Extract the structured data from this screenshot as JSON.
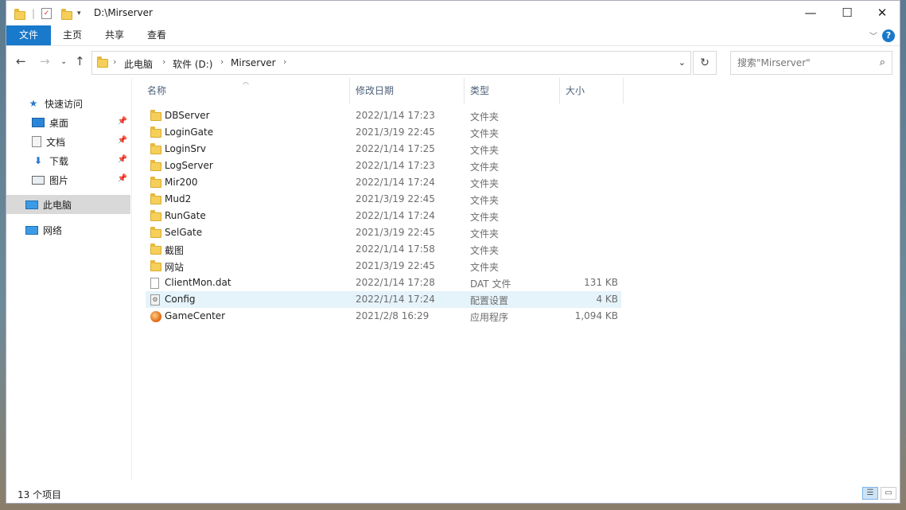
{
  "window": {
    "title": "D:\\Mirserver",
    "minimize_label": "—",
    "maximize_label": "☐",
    "close_label": "✕"
  },
  "ribbon": {
    "tabs": [
      {
        "label": "文件",
        "active": true
      },
      {
        "label": "主页"
      },
      {
        "label": "共享"
      },
      {
        "label": "查看"
      }
    ],
    "help_label": "?"
  },
  "address": {
    "crumbs": [
      "此电脑",
      "软件 (D:)",
      "Mirserver"
    ],
    "search_placeholder": "搜索\"Mirserver\""
  },
  "nav": {
    "items": [
      {
        "label": "快速访问",
        "icon": "star-icon"
      },
      {
        "label": "桌面",
        "icon": "desktop-icon",
        "pinned": true
      },
      {
        "label": "文档",
        "icon": "document-icon",
        "pinned": true
      },
      {
        "label": "下载",
        "icon": "download-icon",
        "pinned": true
      },
      {
        "label": "图片",
        "icon": "pictures-icon",
        "pinned": true
      },
      {
        "label": "此电脑",
        "icon": "computer-icon",
        "selected": true
      },
      {
        "label": "网络",
        "icon": "network-icon"
      }
    ]
  },
  "columns": {
    "name": "名称",
    "date": "修改日期",
    "type": "类型",
    "size": "大小"
  },
  "files": [
    {
      "name": "DBServer",
      "date": "2022/1/14 17:23",
      "type": "文件夹",
      "size": "",
      "icon": "folder-icon"
    },
    {
      "name": "LoginGate",
      "date": "2021/3/19 22:45",
      "type": "文件夹",
      "size": "",
      "icon": "folder-icon"
    },
    {
      "name": "LoginSrv",
      "date": "2022/1/14 17:25",
      "type": "文件夹",
      "size": "",
      "icon": "folder-icon"
    },
    {
      "name": "LogServer",
      "date": "2022/1/14 17:23",
      "type": "文件夹",
      "size": "",
      "icon": "folder-icon"
    },
    {
      "name": "Mir200",
      "date": "2022/1/14 17:24",
      "type": "文件夹",
      "size": "",
      "icon": "folder-icon"
    },
    {
      "name": "Mud2",
      "date": "2021/3/19 22:45",
      "type": "文件夹",
      "size": "",
      "icon": "folder-icon"
    },
    {
      "name": "RunGate",
      "date": "2022/1/14 17:24",
      "type": "文件夹",
      "size": "",
      "icon": "folder-icon"
    },
    {
      "name": "SelGate",
      "date": "2021/3/19 22:45",
      "type": "文件夹",
      "size": "",
      "icon": "folder-icon"
    },
    {
      "name": "截图",
      "date": "2022/1/14 17:58",
      "type": "文件夹",
      "size": "",
      "icon": "folder-icon"
    },
    {
      "name": "网站",
      "date": "2021/3/19 22:45",
      "type": "文件夹",
      "size": "",
      "icon": "folder-icon"
    },
    {
      "name": "ClientMon.dat",
      "date": "2022/1/14 17:28",
      "type": "DAT 文件",
      "size": "131 KB",
      "icon": "file-icon"
    },
    {
      "name": "Config",
      "date": "2022/1/14 17:24",
      "type": "配置设置",
      "size": "4 KB",
      "icon": "config-file-icon",
      "highlighted": true
    },
    {
      "name": "GameCenter",
      "date": "2021/2/8 16:29",
      "type": "应用程序",
      "size": "1,094 KB",
      "icon": "app-icon"
    }
  ],
  "status": {
    "item_count": "13 个项目"
  }
}
